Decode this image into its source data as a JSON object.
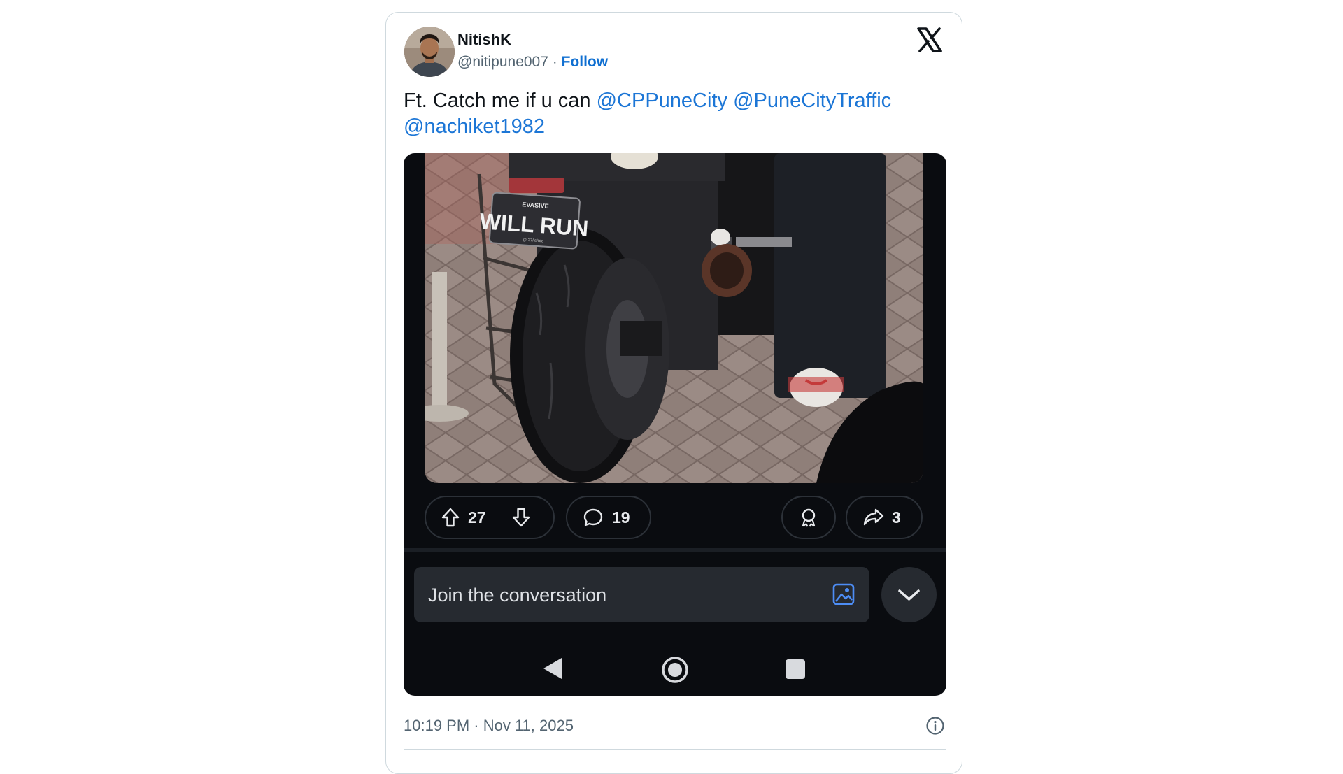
{
  "author": {
    "display_name": "NitishK",
    "handle": "@nitipune007",
    "separator": "·",
    "follow_label": "Follow"
  },
  "tweet": {
    "text_prefix": "Ft. Catch me if u can",
    "mentions": [
      "@CPPuneCity",
      "@PuneCityTraffic",
      "@nachiket1982"
    ]
  },
  "media": {
    "plate": {
      "top_text": "EVASIVE",
      "main_text": "WILL RUN",
      "bottom_text": "@ 27/ishoo"
    },
    "actions": {
      "upvotes": "27",
      "comments": "19",
      "shares": "3"
    },
    "comment_placeholder": "Join the conversation",
    "colors": {
      "background": "#0a0c10",
      "pill_border": "#2c3138",
      "input_background": "#262a30",
      "image_icon": "#4d8df5"
    },
    "icons": [
      "upvote-icon",
      "downvote-icon",
      "comment-icon",
      "award-icon",
      "share-icon",
      "image-icon",
      "chevron-down-icon",
      "back-icon",
      "home-icon",
      "recents-icon"
    ]
  },
  "footer": {
    "timestamp": "10:19 PM · Nov 11, 2025"
  },
  "colors": {
    "link": "#1c76d6",
    "follow": "#0f6fd1",
    "text": "#0f1419",
    "muted": "#536471",
    "border": "#cfd9de"
  }
}
